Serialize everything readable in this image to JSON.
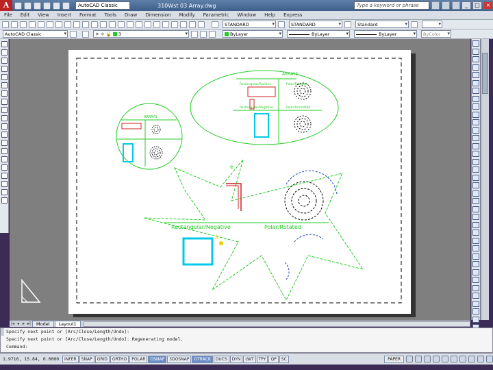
{
  "titlebar": {
    "logo": "A",
    "workspace": "AutoCAD Classic",
    "document_title": "310Wst 03 Array.dwg",
    "search_placeholder": "Type a keyword or phrase",
    "min": "_",
    "max": "□",
    "close": "×"
  },
  "menu": {
    "items": [
      "File",
      "Edit",
      "View",
      "Insert",
      "Format",
      "Tools",
      "Draw",
      "Dimension",
      "Modify",
      "Parametric",
      "Window",
      "Help",
      "Express"
    ]
  },
  "toolbar1": {
    "text_style": "STANDARD",
    "dim_style": "STANDARD",
    "table_style": "Standard"
  },
  "toolbar2": {
    "workspace": "AutoCAD Classic",
    "layer": "3",
    "color": "ByLayer",
    "linetype": "ByLayer",
    "lineweight": "ByLayer",
    "plotstyle": "ByColor"
  },
  "drawing": {
    "arrays_label": "ARRAYS",
    "rect_polar_label": "Rectangular/Positive",
    "polar_rotated_label": "Polar/Rotated",
    "rect_neg_label": "Rectangular/Negative",
    "polar_nonrot_label": "Polar/Unrotated",
    "big_rect_label": "Rectangular/Negative",
    "big_polar_label": "Polar/Rotated",
    "label_e": "e",
    "label_a": "A"
  },
  "tabs": {
    "nav": [
      "|◂",
      "◂",
      "▸",
      "▸|"
    ],
    "items": [
      "Model",
      "Layout1"
    ],
    "active": "Layout1"
  },
  "cmdline": {
    "line1": "Specify next point or [Arc/Close/Length/Undo]:",
    "line2": "Specify next point or [Arc/Close/Length/Undo]: Regenerating model.",
    "line3": "Command:"
  },
  "status": {
    "coords": "1.9716, 15.84, 0.0000",
    "buttons": [
      {
        "label": "INFER",
        "on": false
      },
      {
        "label": "SNAP",
        "on": false
      },
      {
        "label": "GRID",
        "on": false
      },
      {
        "label": "ORTHO",
        "on": false
      },
      {
        "label": "POLAR",
        "on": false
      },
      {
        "label": "OSNAP",
        "on": true
      },
      {
        "label": "3DOSNAP",
        "on": false
      },
      {
        "label": "OTRACK",
        "on": true
      },
      {
        "label": "DUCS",
        "on": false
      },
      {
        "label": "DYN",
        "on": false
      },
      {
        "label": "LWT",
        "on": false
      },
      {
        "label": "TPY",
        "on": false
      },
      {
        "label": "QP",
        "on": false
      },
      {
        "label": "SC",
        "on": false
      }
    ],
    "paper_label": "PAPER"
  },
  "colors": {
    "line_green": "#22cc22",
    "red": "#cc2222",
    "cyan": "#00c8e6",
    "blue": "#2244cc",
    "yellow": "#e6d200"
  }
}
